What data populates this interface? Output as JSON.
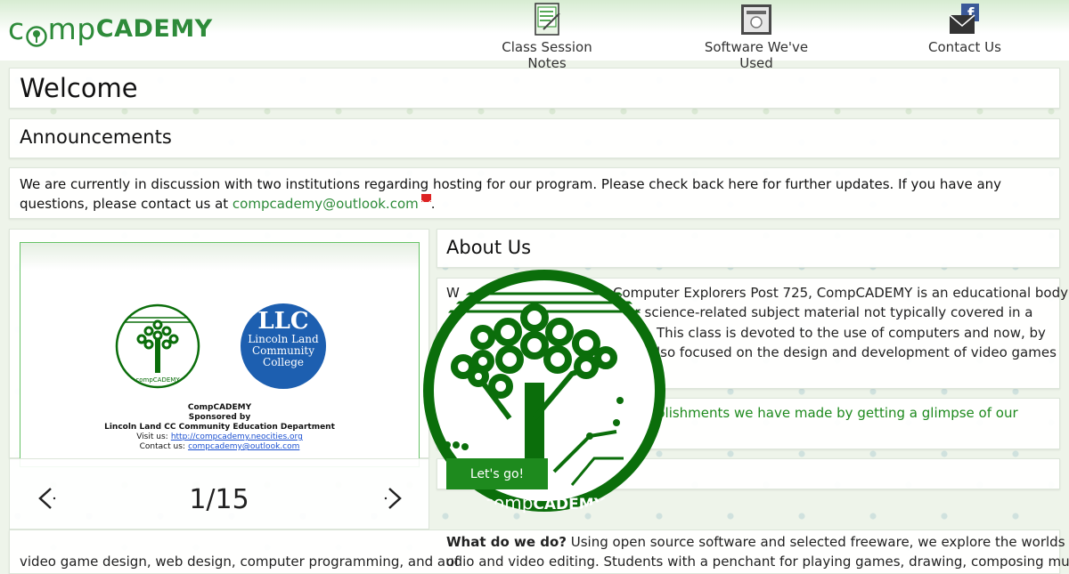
{
  "logo": {
    "part1": "comp",
    "part2": "CADEMY"
  },
  "nav": [
    {
      "label": "Class Session Notes",
      "icon": "notes-icon"
    },
    {
      "label": "Software We've Used",
      "icon": "software-icon"
    },
    {
      "label": "Contact Us",
      "icon": "contact-mail-icon"
    }
  ],
  "welcome": {
    "title": "Welcome"
  },
  "announcements": {
    "title": "Announcements",
    "text_before": "We are currently in discussion with two institutions regarding hosting for our program. Please check back here for further updates. If you have any questions, please contact us at ",
    "email": "compcademy@outlook.com",
    "text_after": "."
  },
  "slideshow": {
    "slide": {
      "partner_logo_line1": "Lincoln Land",
      "partner_logo_line2": "Community",
      "partner_logo_line3": "College",
      "caption_title": "CompCADEMY",
      "caption_sponsor_1": "Sponsored by",
      "caption_sponsor_2": "Lincoln Land CC Community Education Department",
      "visit_label": "Visit us:",
      "visit_link": "http://compcademy.neocities.org",
      "contact_label": "Contact us:",
      "contact_link": "compcademy@outlook.com",
      "small_logo_text": "compCADEMY"
    },
    "counter": "1/15"
  },
  "about": {
    "title": "About Us",
    "para1_line1": "Computer Explorers Post 725, CompCADEMY is an educational body",
    "para1_line2": "uter science-related subject material not typically covered in a",
    "para1_line3": "This class is devoted to the use of computers and now, by",
    "para1_line4": "lso focused on the design and development of video games",
    "para1_start": "W",
    "highlight": "plishments we have made by getting a glimpse of our",
    "cta": "Let's go!",
    "circle_logo_text_1": "comp",
    "circle_logo_text_2": "CADEMY",
    "what_label": "What do we do?",
    "what_text": " Using open source software and selected freeware, we explore the worlds of",
    "what_text_2": "video game design, web design, computer programming, and audio and video editing. Students with a penchant for playing games, drawing, composing music, and"
  },
  "colors": {
    "brand_green": "#2e8b3a",
    "button_green": "#1e8a1e",
    "dark_green": "#0b6e0b"
  }
}
